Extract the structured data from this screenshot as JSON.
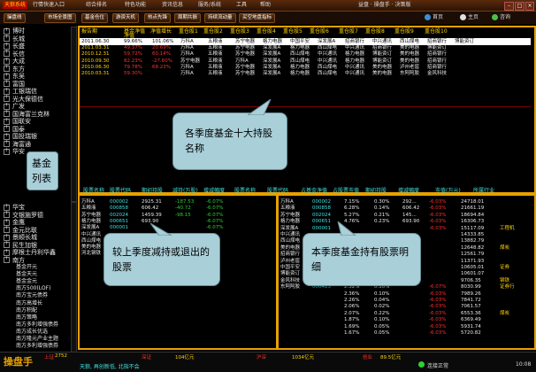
{
  "titlebar": {
    "logo": "天狼系统",
    "menus": [
      "行情快速入口",
      "综合排名",
      "特色功能",
      "资讯信息",
      "服务/系统",
      "工具",
      "帮助"
    ],
    "title": "益盘 · 操盘手 · 决策版"
  },
  "toolbar": {
    "buttons": [
      "操盘线",
      "市场全景图",
      "基金仓位",
      "游资天机",
      "热点先锋",
      "周期共振",
      "持续流动量",
      "买空地盘指标"
    ],
    "links": [
      "首页",
      "主页",
      "咨询"
    ]
  },
  "tree": {
    "top_items": [
      "博时",
      "长城",
      "长盛",
      "长信",
      "大成",
      "东方",
      "东吴",
      "富国",
      "工银瑞信",
      "光大保德信",
      "广发",
      "国海富兰克林",
      "国联安",
      "国泰",
      "国投瑞银",
      "海富通",
      "华安"
    ],
    "mid_items": [
      "华宝",
      "交银施罗德",
      "金鹰",
      "金元比联",
      "景顺长城",
      "民生加银",
      "摩根士丹利华鑫",
      "南方"
    ],
    "sub_items": [
      "基金开元",
      "基金天元",
      "基金金元",
      "南方500(LOF)",
      "南方宝元债券",
      "南方高增长",
      "南方积配",
      "南方策略",
      "南方多利增强债券",
      "南方成长优选",
      "南方隆元产业主题",
      "南方多利增强债券"
    ]
  },
  "top_table": {
    "header_row1": [
      "报告期",
      "基金净值",
      "净值增长",
      "重仓股1",
      "重仓股2",
      "重仓股3",
      "重仓股4",
      "重仓股5",
      "重仓股6",
      "重仓股7",
      "重仓股8",
      "重仓股9",
      "重仓股10"
    ],
    "header_row2": [
      "",
      "净值",
      "",
      "",
      "",
      "",
      "",
      "",
      "",
      "",
      "",
      "",
      ""
    ],
    "rows": [
      {
        "date": "2011.06.30",
        "v1": "99.66%",
        "v2": "101.06%",
        "stocks": [
          "万科A",
          "五粮液",
          "苏宁电器",
          "格力电器",
          "中国平安",
          "深发展A",
          "招商银行",
          "中兴通讯",
          "西山煤电",
          "招商银行",
          "博能资订"
        ]
      },
      {
        "date": "2011.03.31",
        "v1": "49.37%",
        "v2": "20.69%",
        "stocks": [
          "万科A",
          "五粮液",
          "苏宁电器",
          "深发展A",
          "格力电器",
          "西山煤电",
          "中兴通讯",
          "招商银行",
          "美的电器",
          "博能资订"
        ]
      },
      {
        "date": "2010.12.31",
        "v1": "59.72%",
        "v2": "60.14%",
        "stocks": [
          "万科A",
          "五粮液",
          "苏宁电器",
          "深发展A",
          "西山煤电",
          "中兴通讯",
          "格力电器",
          "博能资订",
          "美的电器",
          "招商银行"
        ]
      },
      {
        "date": "2010.09.30",
        "v1": "82.23%",
        "v2": "-27.60%",
        "stocks": [
          "苏宁电器",
          "五粮液",
          "万科A",
          "深发展A",
          "西山煤电",
          "中兴通讯",
          "格力电器",
          "博能资订",
          "美的电器",
          "招商银行"
        ]
      },
      {
        "date": "2010.06.30",
        "v1": "79.78%",
        "v2": "68.23%",
        "stocks": [
          "万科A",
          "五粮液",
          "苏宁电器",
          "深发展A",
          "格力电器",
          "西山煤电",
          "中兴通讯",
          "美的电器",
          "泸州老窖",
          "招商银行"
        ]
      },
      {
        "date": "2010.03.31",
        "v1": "59.30%",
        "v2": "",
        "stocks": [
          "万科A",
          "五粮液",
          "苏宁电器",
          "深发展A",
          "格力电器",
          "西山煤电",
          "中兴通讯",
          "美的电器",
          "东阿阿胶",
          "金风科技"
        ]
      }
    ]
  },
  "bottom_header": [
    "股票名称",
    "股票代码",
    "期初持股",
    "减持(万股)",
    "增减幅度",
    "股票名称",
    "股票代码",
    "占基金净值",
    "占股票市值",
    "期初持股",
    "增减幅度",
    "市值(万元)",
    "所属行业"
  ],
  "left_table": {
    "rows": [
      {
        "name": "万科A",
        "code": "000002",
        "hold": "2925.31",
        "chg": "-187.53",
        "pct": "-6.07%"
      },
      {
        "name": "五粮液",
        "code": "000858",
        "hold": "606.42",
        "chg": "-40.72",
        "pct": "-6.07%"
      },
      {
        "name": "苏宁电器",
        "code": "002024",
        "hold": "1459.39",
        "chg": "-98.15",
        "pct": "-6.07%"
      },
      {
        "name": "格力电器",
        "code": "000651",
        "hold": "693.90",
        "chg": "",
        "pct": "-6.07%"
      },
      {
        "name": "深发展A",
        "code": "000001",
        "hold": "",
        "chg": "",
        "pct": "-6.07%"
      },
      {
        "name": "中兴通讯",
        "code": "",
        "hold": "",
        "chg": "",
        "pct": ""
      },
      {
        "name": "西山煤电",
        "code": "",
        "hold": "",
        "chg": "",
        "pct": ""
      },
      {
        "name": "美的电器",
        "code": "",
        "hold": "",
        "chg": "",
        "pct": ""
      },
      {
        "name": "河北钢铁",
        "code": "",
        "hold": "",
        "chg": "",
        "pct": ""
      }
    ]
  },
  "right_table": {
    "rows": [
      {
        "name": "万科A",
        "code": "000002",
        "p1": "7.15%",
        "p2": "0.30%",
        "hold": "292...",
        "pct": "-6.03%",
        "val": "24718.01",
        "ind": ""
      },
      {
        "name": "五粮液",
        "code": "000858",
        "p1": "6.28%",
        "p2": "0.14%",
        "hold": "606.42",
        "pct": "-6.03%",
        "val": "21661.19",
        "ind": ""
      },
      {
        "name": "苏宁电器",
        "code": "002024",
        "p1": "5.27%",
        "p2": "0.21%",
        "hold": "145...",
        "pct": "-6.03%",
        "val": "18694.84",
        "ind": ""
      },
      {
        "name": "格力电器",
        "code": "000651",
        "p1": "4.76%",
        "p2": "0.23%",
        "hold": "693.90",
        "pct": "-6.03%",
        "val": "16306.73",
        "ind": ""
      },
      {
        "name": "深发展A",
        "code": "000001",
        "p1": "",
        "p2": "",
        "hold": "",
        "pct": "-6.03%",
        "val": "15117.09",
        "ind": "工程机"
      },
      {
        "name": "中兴通讯",
        "code": "",
        "p1": "",
        "p2": "",
        "hold": "",
        "pct": "",
        "val": "14333.85",
        "ind": ""
      },
      {
        "name": "西山煤电",
        "code": "",
        "p1": "",
        "p2": "",
        "hold": "",
        "pct": "",
        "val": "13882.79",
        "ind": ""
      },
      {
        "name": "美的电器",
        "code": "",
        "p1": "",
        "p2": "",
        "hold": "",
        "pct": "",
        "val": "12648.82",
        "ind": "煤炭"
      },
      {
        "name": "招商银行",
        "code": "",
        "p1": "",
        "p2": "",
        "hold": "",
        "pct": "",
        "val": "12561.79",
        "ind": ""
      },
      {
        "name": "泸州老窖",
        "code": "",
        "p1": "",
        "p2": "",
        "hold": "",
        "pct": "",
        "val": "11371.93",
        "ind": ""
      },
      {
        "name": "中国平安",
        "code": "",
        "p1": "",
        "p2": "",
        "hold": "",
        "pct": "",
        "val": "10605.01",
        "ind": "证券"
      },
      {
        "name": "博能资订",
        "code": "",
        "p1": "",
        "p2": "",
        "hold": "",
        "pct": "",
        "val": "10601.07",
        "ind": ""
      },
      {
        "name": "金风科技",
        "code": "",
        "p1": "",
        "p2": "",
        "hold": "",
        "pct": "",
        "val": "9706.35",
        "ind": "钢铁"
      },
      {
        "name": "东阿阿胶",
        "code": "000423",
        "p1": "2.32%",
        "p2": "0.10%",
        "hold": "",
        "pct": "-6.07%",
        "val": "8030.99",
        "ind": "证券行"
      },
      {
        "name": "",
        "code": "",
        "p1": "2.36%",
        "p2": "0.10%",
        "hold": "",
        "pct": "-6.03%",
        "val": "7989.26",
        "ind": ""
      },
      {
        "name": "",
        "code": "",
        "p1": "2.26%",
        "p2": "0.04%",
        "hold": "",
        "pct": "-6.03%",
        "val": "7841.72",
        "ind": ""
      },
      {
        "name": "",
        "code": "",
        "p1": "2.06%",
        "p2": "0.02%",
        "hold": "",
        "pct": "-6.03%",
        "val": "7061.57",
        "ind": ""
      },
      {
        "name": "",
        "code": "",
        "p1": "2.07%",
        "p2": "0.22%",
        "hold": "",
        "pct": "-6.03%",
        "val": "6553.36",
        "ind": "煤炭"
      },
      {
        "name": "",
        "code": "",
        "p1": "1.87%",
        "p2": "0.10%",
        "hold": "",
        "pct": "-6.03%",
        "val": "6369.49",
        "ind": ""
      },
      {
        "name": "",
        "code": "",
        "p1": "1.69%",
        "p2": "0.05%",
        "hold": "",
        "pct": "-6.03%",
        "val": "5931.74",
        "ind": ""
      },
      {
        "name": "",
        "code": "",
        "p1": "1.67%",
        "p2": "0.05%",
        "hold": "",
        "pct": "-6.03%",
        "val": "5720.82",
        "ind": ""
      }
    ]
  },
  "callouts": {
    "top": "各季度基金十大持股名称",
    "left": "基金列表",
    "bottom_left": "较上季度减持或退出的股票",
    "bottom_right": "本季度基金持有股票明细"
  },
  "statusbar": {
    "brand": "操盘手",
    "indices": [
      "上证",
      "深证",
      "沪深",
      "创业"
    ],
    "values": [
      "2752",
      "104亿元",
      "1034亿元",
      "89.5亿元"
    ],
    "msg": "天狼, 再创新低, 北指不会",
    "status": "连接正常",
    "time": "10:08"
  }
}
